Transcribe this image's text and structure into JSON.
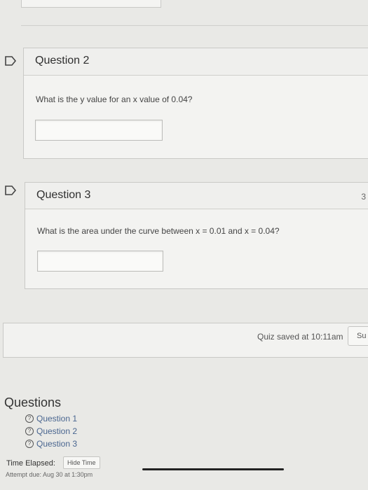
{
  "question2": {
    "title": "Question 2",
    "text": "What is the y value for an x value of 0.04?",
    "answer_value": ""
  },
  "question3": {
    "title": "Question 3",
    "text": "What is the area under the curve between x = 0.01 and x = 0.04?",
    "answer_value": "",
    "side_fragment": "3"
  },
  "footer": {
    "saved_text": "Quiz saved at 10:11am",
    "submit_label": "Su"
  },
  "sidebar": {
    "heading": "Questions",
    "items": [
      {
        "label": "Question 1",
        "icon": "question-circle-icon"
      },
      {
        "label": "Question 2",
        "icon": "question-circle-icon"
      },
      {
        "label": "Question 3",
        "icon": "question-circle-icon"
      }
    ],
    "time_label": "Time Elapsed:",
    "hide_time_label": "Hide Time",
    "attempt_due": "Attempt due: Aug 30 at 1:30pm"
  },
  "colors": {
    "link": "#4a6690",
    "background": "#e9e9e6",
    "panel": "#f3f3f1"
  }
}
